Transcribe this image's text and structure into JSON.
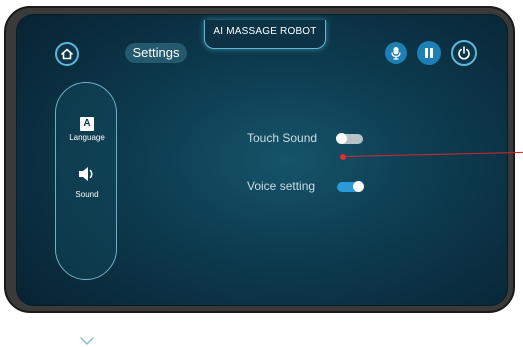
{
  "header": {
    "title": "AI MASSAGE ROBOT",
    "settings_label": "Settings"
  },
  "sidebar": {
    "items": [
      {
        "label": "Language",
        "icon": "language-icon"
      },
      {
        "label": "Sound",
        "icon": "speaker-icon"
      }
    ]
  },
  "settings": {
    "touch_sound": {
      "label": "Touch Sound",
      "enabled": false
    },
    "voice_setting": {
      "label": "Voice setting",
      "enabled": true
    }
  },
  "colors": {
    "accent": "#5fb7d8",
    "button_fill": "#1e7fb4",
    "toggle_on": "#2a9ad8",
    "annotation": "#d9262a"
  }
}
